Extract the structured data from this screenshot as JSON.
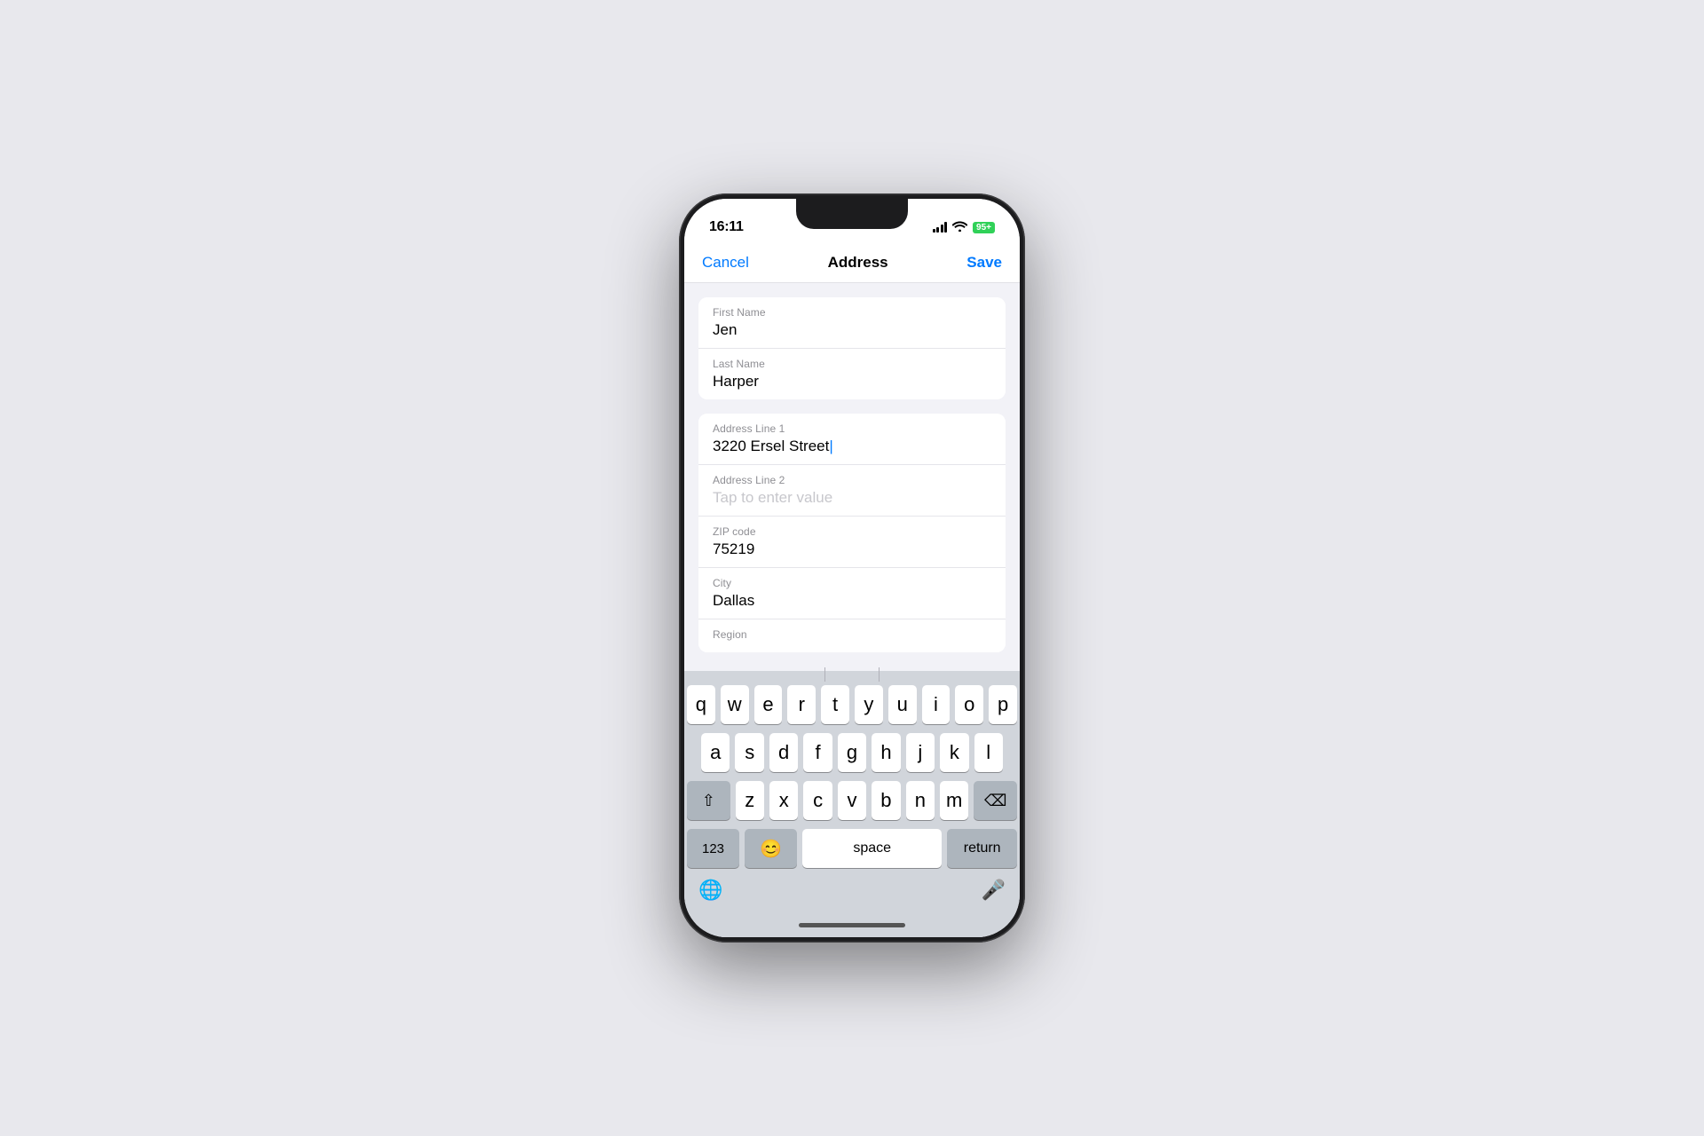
{
  "status_bar": {
    "time": "16:11",
    "battery": "95+",
    "wifi": "wifi"
  },
  "nav": {
    "cancel_label": "Cancel",
    "title": "Address",
    "save_label": "Save"
  },
  "form": {
    "sections": [
      {
        "fields": [
          {
            "label": "First Name",
            "value": "Jen",
            "placeholder": ""
          },
          {
            "label": "Last Name",
            "value": "Harper",
            "placeholder": ""
          }
        ]
      },
      {
        "fields": [
          {
            "label": "Address Line 1",
            "value": "3220 Ersel Street",
            "placeholder": "",
            "active": true
          },
          {
            "label": "Address Line 2",
            "value": "",
            "placeholder": "Tap to enter value"
          },
          {
            "label": "ZIP code",
            "value": "75219",
            "placeholder": ""
          },
          {
            "label": "City",
            "value": "Dallas",
            "placeholder": ""
          },
          {
            "label": "Region",
            "value": "",
            "placeholder": ""
          }
        ]
      }
    ]
  },
  "keyboard": {
    "rows": [
      [
        "q",
        "w",
        "e",
        "r",
        "t",
        "y",
        "u",
        "i",
        "o",
        "p"
      ],
      [
        "a",
        "s",
        "d",
        "f",
        "g",
        "h",
        "j",
        "k",
        "l"
      ],
      [
        "z",
        "x",
        "c",
        "v",
        "b",
        "n",
        "m"
      ]
    ],
    "special": {
      "shift": "⇧",
      "backspace": "⌫",
      "numbers": "123",
      "emoji": "😊",
      "space": "space",
      "return": "return",
      "globe": "🌐",
      "mic": "🎤"
    }
  }
}
